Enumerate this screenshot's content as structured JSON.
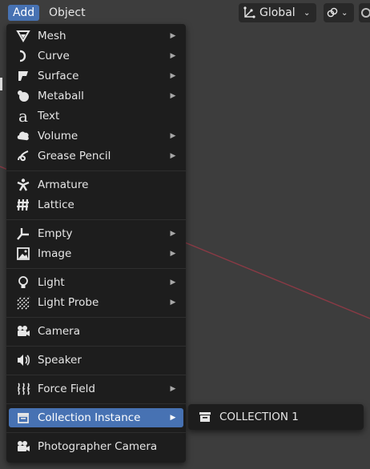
{
  "topbar": {
    "tabs": [
      {
        "label": "Add",
        "active": true
      },
      {
        "label": "Object",
        "active": false
      }
    ],
    "orientation_label": "Global",
    "orientation_icon": "transform-orientation-icon",
    "snap_icon": "snap-link-icon"
  },
  "add_menu": {
    "items": [
      {
        "label": "Mesh",
        "icon": "mesh-icon",
        "submenu": true
      },
      {
        "label": "Curve",
        "icon": "curve-icon",
        "submenu": true
      },
      {
        "label": "Surface",
        "icon": "surface-icon",
        "submenu": true
      },
      {
        "label": "Metaball",
        "icon": "metaball-icon",
        "submenu": true
      },
      {
        "label": "Text",
        "icon": "text-icon",
        "submenu": false
      },
      {
        "label": "Volume",
        "icon": "volume-icon",
        "submenu": true
      },
      {
        "label": "Grease Pencil",
        "icon": "grease-pencil-icon",
        "submenu": true
      },
      {
        "label": "Armature",
        "icon": "armature-icon",
        "submenu": false
      },
      {
        "label": "Lattice",
        "icon": "lattice-icon",
        "submenu": false
      },
      {
        "label": "Empty",
        "icon": "empty-icon",
        "submenu": true
      },
      {
        "label": "Image",
        "icon": "image-icon",
        "submenu": true
      },
      {
        "label": "Light",
        "icon": "light-icon",
        "submenu": true
      },
      {
        "label": "Light Probe",
        "icon": "light-probe-icon",
        "submenu": true
      },
      {
        "label": "Camera",
        "icon": "camera-icon",
        "submenu": false
      },
      {
        "label": "Speaker",
        "icon": "speaker-icon",
        "submenu": false
      },
      {
        "label": "Force Field",
        "icon": "force-field-icon",
        "submenu": true
      },
      {
        "label": "Collection Instance",
        "icon": "collection-instance-icon",
        "submenu": true,
        "highlighted": true
      },
      {
        "label": "Photographer Camera",
        "icon": "photographer-camera-icon",
        "submenu": false
      }
    ]
  },
  "collection_submenu": {
    "items": [
      {
        "label": "COLLECTION 1",
        "icon": "collection-icon"
      }
    ]
  },
  "colors": {
    "accent": "#4772b3",
    "menu_bg": "#1d1d1d",
    "viewport_bg": "#3d3d3d",
    "axis_line": "#8a3a45"
  }
}
